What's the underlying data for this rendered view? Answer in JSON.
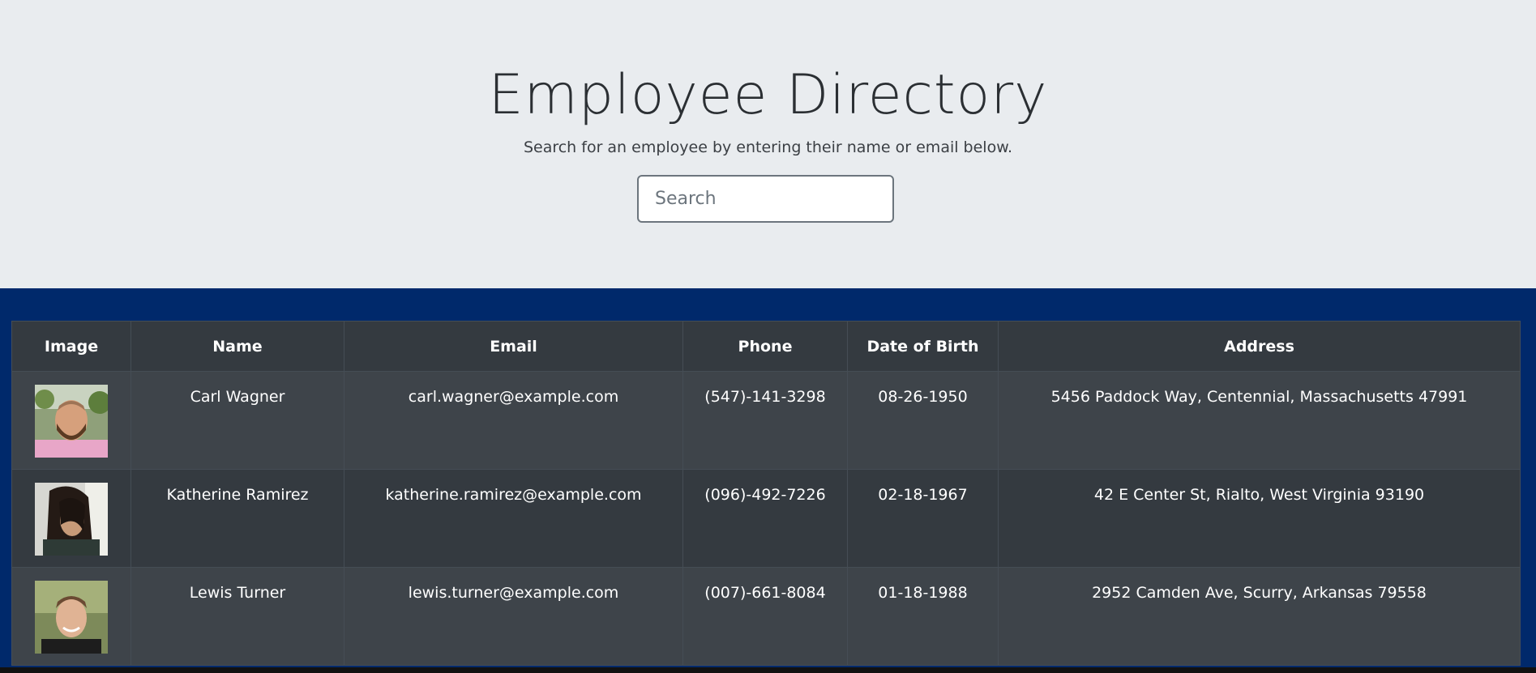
{
  "header": {
    "title": "Employee Directory",
    "subtitle": "Search for an employee by entering their name or email below.",
    "search_placeholder": "Search"
  },
  "table": {
    "columns": [
      "Image",
      "Name",
      "Email",
      "Phone",
      "Date of Birth",
      "Address"
    ],
    "rows": [
      {
        "image": "portrait-photo-bearded-man",
        "name": "Carl Wagner",
        "email": "carl.wagner@example.com",
        "phone": "(547)-141-3298",
        "dob": "08-26-1950",
        "address": "5456 Paddock Way, Centennial, Massachusetts 47991"
      },
      {
        "image": "portrait-photo-woman-dark-hair",
        "name": "Katherine Ramirez",
        "email": "katherine.ramirez@example.com",
        "phone": "(096)-492-7226",
        "dob": "02-18-1967",
        "address": "42 E Center St, Rialto, West Virginia 93190"
      },
      {
        "image": "portrait-photo-smiling-man",
        "name": "Lewis Turner",
        "email": "lewis.turner@example.com",
        "phone": "(007)-661-8084",
        "dob": "01-18-1988",
        "address": "2952 Camden Ave, Scurry, Arkansas 79558"
      }
    ]
  },
  "colors": {
    "hero_bg": "#e9ecef",
    "band_bg": "#00296b",
    "table_header_bg": "#343a40",
    "row_odd_bg": "#3e444a",
    "row_even_bg": "#343a40"
  }
}
